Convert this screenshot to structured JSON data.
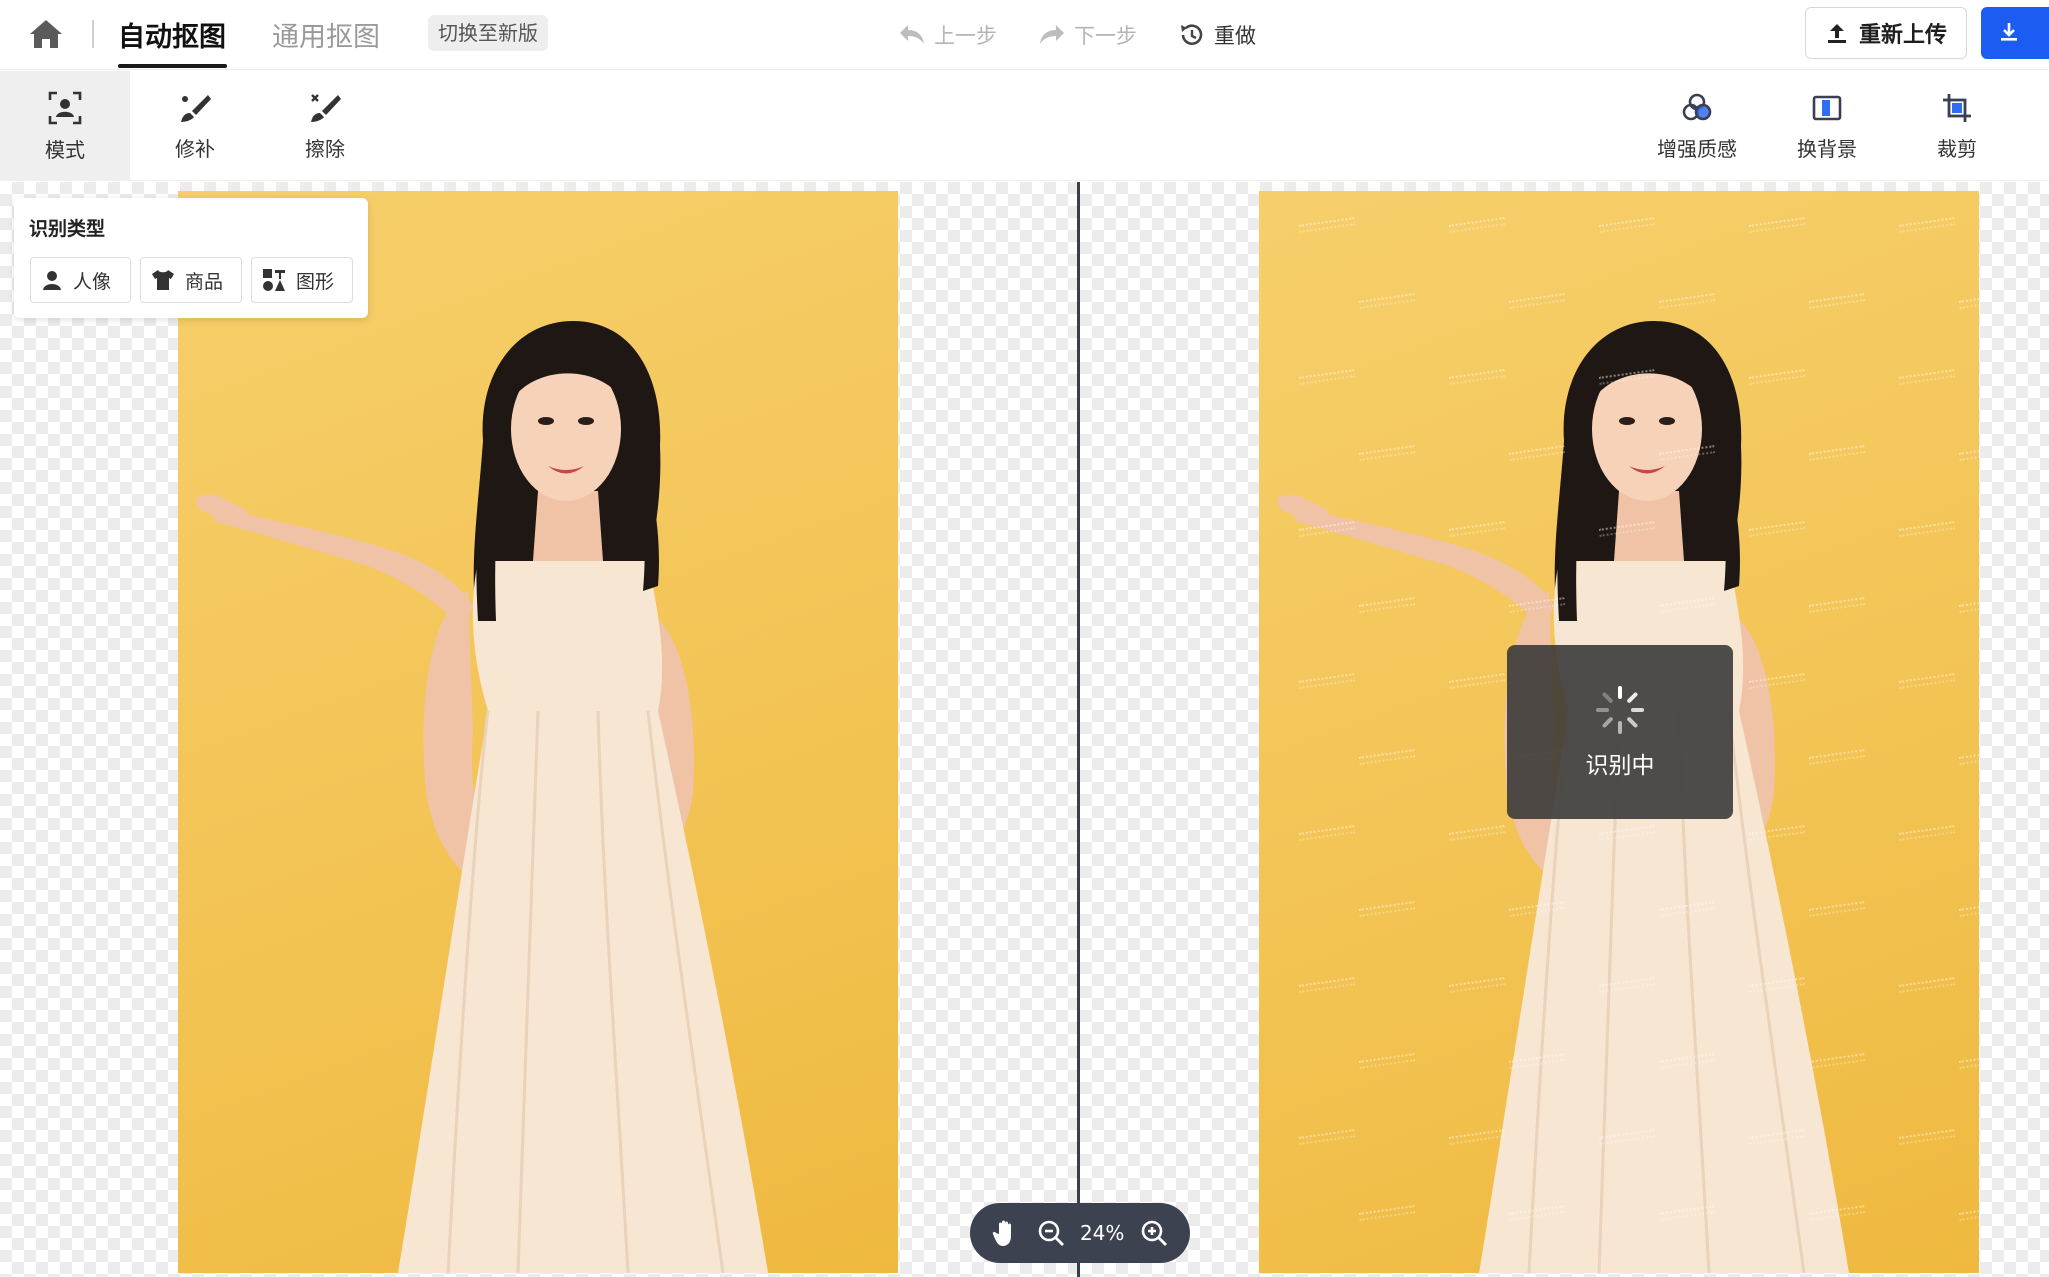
{
  "header": {
    "tab_auto": "自动抠图",
    "tab_general": "通用抠图",
    "switch_label": "切换至新版",
    "undo_label": "上一步",
    "redo_label": "下一步",
    "reset_label": "重做",
    "reupload_label": "重新上传"
  },
  "toolbar": {
    "left_tools": [
      {
        "label": "模式",
        "icon": "mode-portrait-icon",
        "active": true
      },
      {
        "label": "修补",
        "icon": "brush-repair-icon",
        "active": false
      },
      {
        "label": "擦除",
        "icon": "eraser-icon",
        "active": false
      }
    ],
    "right_tools": [
      {
        "label": "增强质感",
        "icon": "enhance-texture-icon"
      },
      {
        "label": "换背景",
        "icon": "change-background-icon"
      },
      {
        "label": "裁剪",
        "icon": "crop-icon"
      }
    ]
  },
  "type_panel": {
    "title": "识别类型",
    "options": [
      "人像",
      "商品",
      "图形"
    ]
  },
  "loading": {
    "text": "识别中"
  },
  "zoom": {
    "level": "24%"
  },
  "colors": {
    "accent": "#1d5cf2",
    "photo_bg": "#f3c455",
    "divider": "#3b3f47",
    "zoom_pill": "#3d4250"
  }
}
